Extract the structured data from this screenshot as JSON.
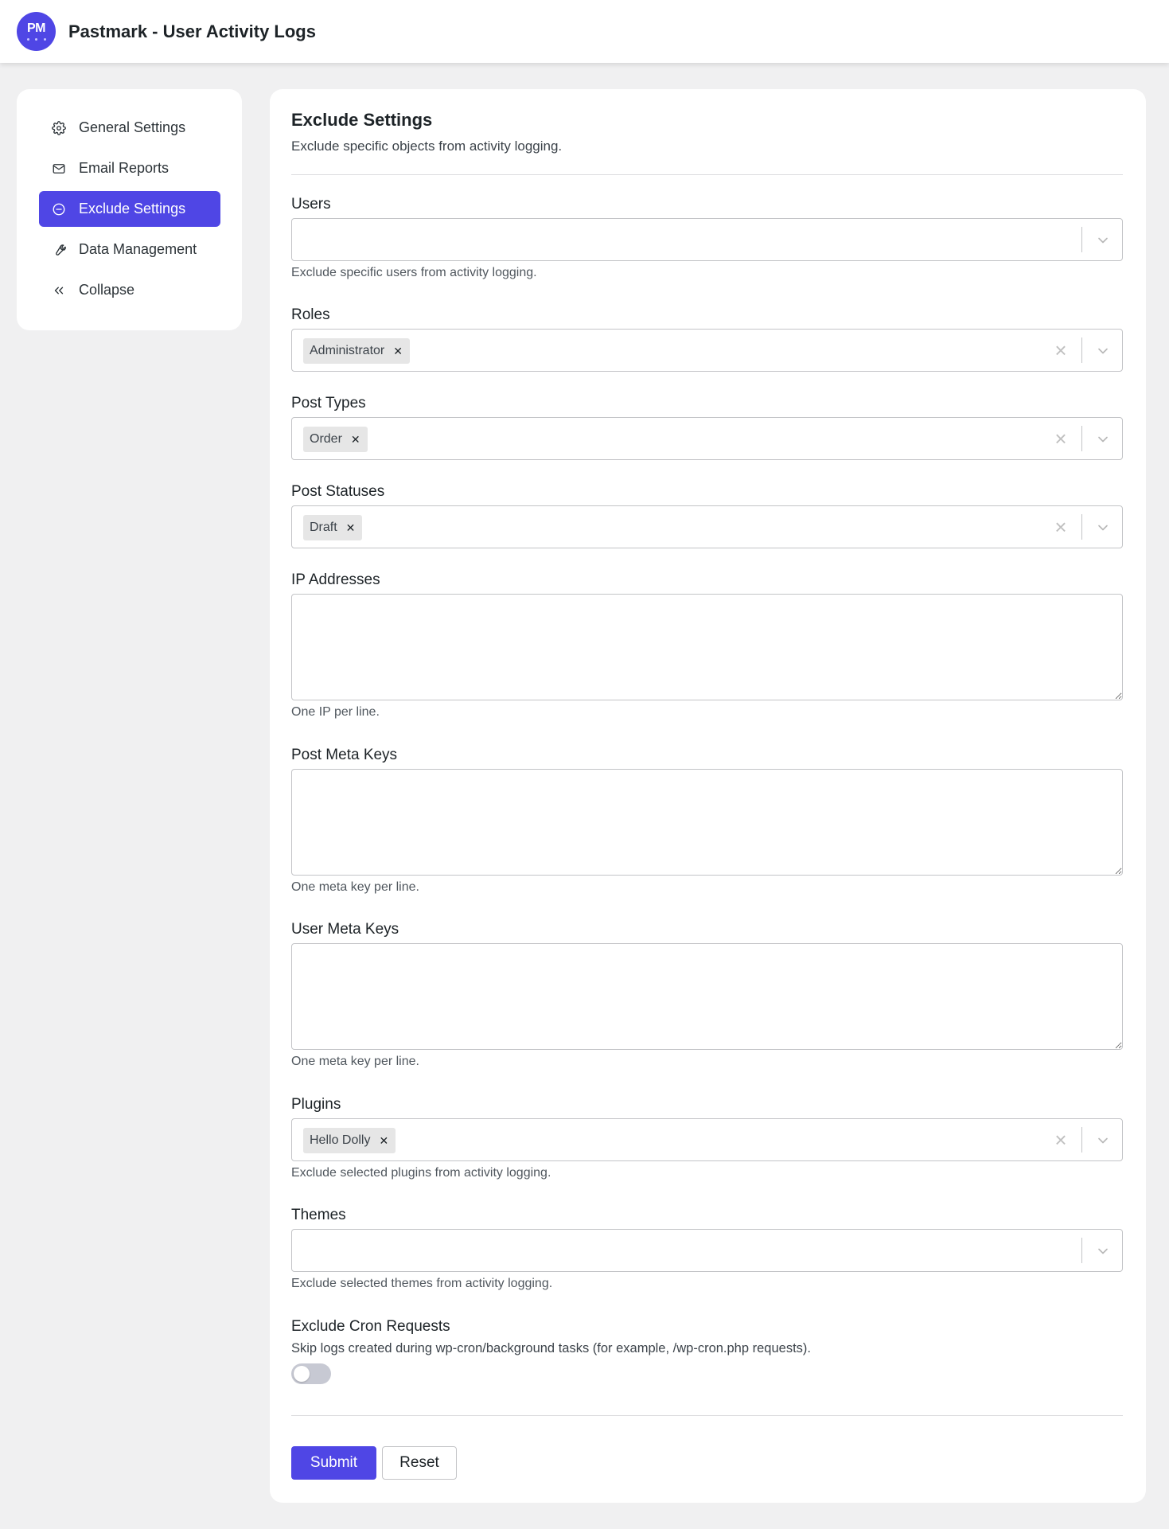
{
  "app": {
    "logo_text": "PM",
    "title": "Pastmark - User Activity Logs"
  },
  "colors": {
    "accent": "#4f46e5",
    "background": "#f0f0f1"
  },
  "sidebar": {
    "items": [
      {
        "label": "General Settings",
        "icon": "gear-icon",
        "active": false
      },
      {
        "label": "Email Reports",
        "icon": "mail-icon",
        "active": false
      },
      {
        "label": "Exclude Settings",
        "icon": "minus-circle-icon",
        "active": true
      },
      {
        "label": "Data Management",
        "icon": "wrench-icon",
        "active": false
      },
      {
        "label": "Collapse",
        "icon": "chevrons-left-icon",
        "active": false
      }
    ]
  },
  "main": {
    "title": "Exclude Settings",
    "subtitle": "Exclude specific objects from activity logging.",
    "fields": {
      "users": {
        "label": "Users",
        "help": "Exclude specific users from activity logging."
      },
      "roles": {
        "label": "Roles",
        "selected": "Administrator"
      },
      "post_types": {
        "label": "Post Types",
        "selected": "Order"
      },
      "post_statuses": {
        "label": "Post Statuses",
        "selected": "Draft"
      },
      "ip_addresses": {
        "label": "IP Addresses",
        "value": "",
        "help": "One IP per line."
      },
      "post_meta_keys": {
        "label": "Post Meta Keys",
        "value": "",
        "help": "One meta key per line."
      },
      "user_meta_keys": {
        "label": "User Meta Keys",
        "value": "",
        "help": "One meta key per line."
      },
      "plugins": {
        "label": "Plugins",
        "selected": "Hello Dolly",
        "help": "Exclude selected plugins from activity logging."
      },
      "themes": {
        "label": "Themes",
        "help": "Exclude selected themes from activity logging."
      },
      "exclude_cron": {
        "label": "Exclude Cron Requests",
        "help": "Skip logs created during wp-cron/background tasks (for example, /wp-cron.php requests).",
        "enabled": false
      }
    },
    "buttons": {
      "submit": "Submit",
      "reset": "Reset"
    }
  }
}
